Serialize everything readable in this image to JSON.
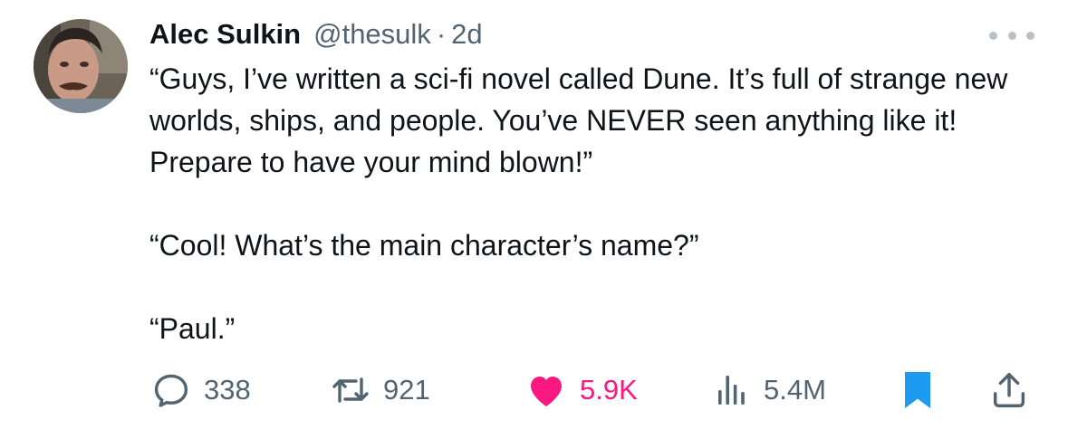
{
  "tweet": {
    "author_name": "Alec Sulkin",
    "handle": "@thesulk",
    "separator": "·",
    "time": "2d",
    "paragraphs": [
      "“Guys, I’ve written a sci-fi novel called Dune. It’s full of strange new worlds, ships, and people. You’ve NEVER seen anything like it! Prepare to have your mind blown!”",
      "“Cool! What’s the main character’s name?”",
      "“Paul.”"
    ]
  },
  "actions": {
    "replies": "338",
    "retweets": "921",
    "likes": "5.9K",
    "views": "5.4M"
  },
  "colors": {
    "text": "#0f1419",
    "secondary": "#536471",
    "like": "#f91880",
    "bookmark": "#1d9bf0"
  },
  "icons": [
    "avatar",
    "more-icon",
    "reply-icon",
    "retweet-icon",
    "like-icon",
    "views-icon",
    "bookmark-icon",
    "share-icon"
  ]
}
